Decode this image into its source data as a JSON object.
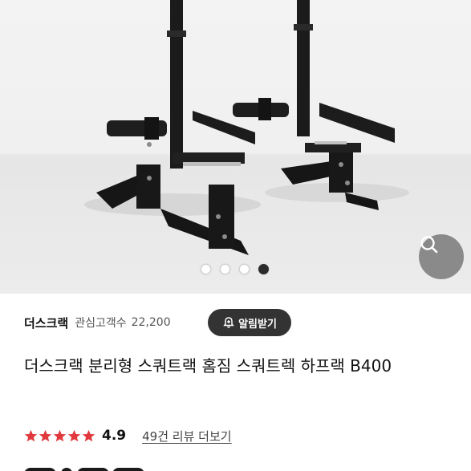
{
  "gallery": {
    "slide_count": 4,
    "active_index": 3,
    "zoom_icon": "search-icon"
  },
  "seller": {
    "name": "더스크랙",
    "interest_label": "관심고객수",
    "interest_count": "22,200"
  },
  "alarm_button": {
    "label": "알림받기",
    "icon": "bell-plus-icon"
  },
  "product": {
    "title": "더스크랙 분리형 스쿼트랙 홈짐 스쿼트렉 하프랙 B400"
  },
  "rating": {
    "stars": 5,
    "value": "4.9",
    "star_color": "#e0393e",
    "review_link": "49건 리뷰 더보기"
  }
}
